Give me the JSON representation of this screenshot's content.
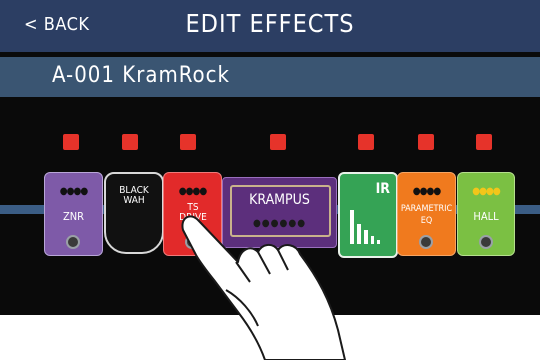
{
  "header": {
    "back_label": "< BACK",
    "title": "EDIT EFFECTS"
  },
  "patch": {
    "name": "A-001 KramRock"
  },
  "pedals": [
    {
      "label": "ZNR",
      "knobs": "●●●●"
    },
    {
      "label": "BLACK WAH"
    },
    {
      "label": "TS DRIVE",
      "knobs": "●●●●"
    },
    {
      "label": "KRAMPUS",
      "knobs": "●●●●●●"
    },
    {
      "label": "IR"
    },
    {
      "label": "PARAMETRIC EQ",
      "knobs": "●●●●"
    },
    {
      "label": "HALL",
      "knobs": "●●●●"
    }
  ]
}
